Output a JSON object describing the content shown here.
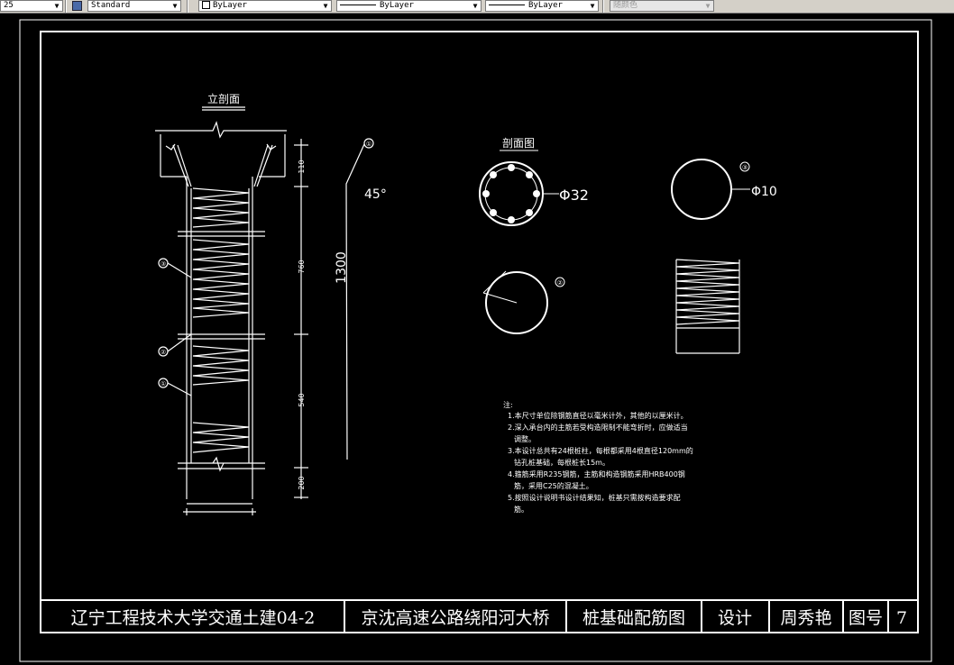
{
  "toolbar": {
    "combo1": "25",
    "textstyle": "Standard",
    "layer": "ByLayer",
    "linetype": "ByLayer",
    "lineweight": "ByLayer",
    "plotstyle": "随颜色"
  },
  "drawing": {
    "elevation_title": "立剖面",
    "section_title": "剖面图",
    "dims": [
      "110",
      "760",
      "540",
      "200"
    ],
    "bar_length": "1300",
    "bend_angle": "45°",
    "callouts": [
      "①",
      "②",
      "③"
    ],
    "main_bar_dia": "Φ32",
    "hoop_dia": "Φ10",
    "notes_header": "注:",
    "notes": [
      "1.本尺寸单位除钢筋直径以毫米计外，其他的以厘米计。",
      "2.深入承台内的主筋若受构造限制不能弯折时，应做适当",
      "调整。",
      "3.本设计总共有24根桩柱，每根都采用4根直径120mm的",
      "钻孔桩基础，每根桩长15m。",
      "4.箍筋采用R235钢筋，主筋和构造钢筋采用HRB400钢",
      "筋，采用C25的混凝土。",
      "5.按照设计说明书设计结果知，桩基只需按构造要求配",
      "筋。"
    ]
  },
  "title_block": {
    "school": "辽宁工程技术大学交通土建04-2",
    "project": "京沈高速公路绕阳河大桥",
    "drawing_name": "桩基础配筋图",
    "design_label": "设计",
    "designer": "周秀艳",
    "sheet_label": "图号",
    "sheet_no": "7"
  }
}
